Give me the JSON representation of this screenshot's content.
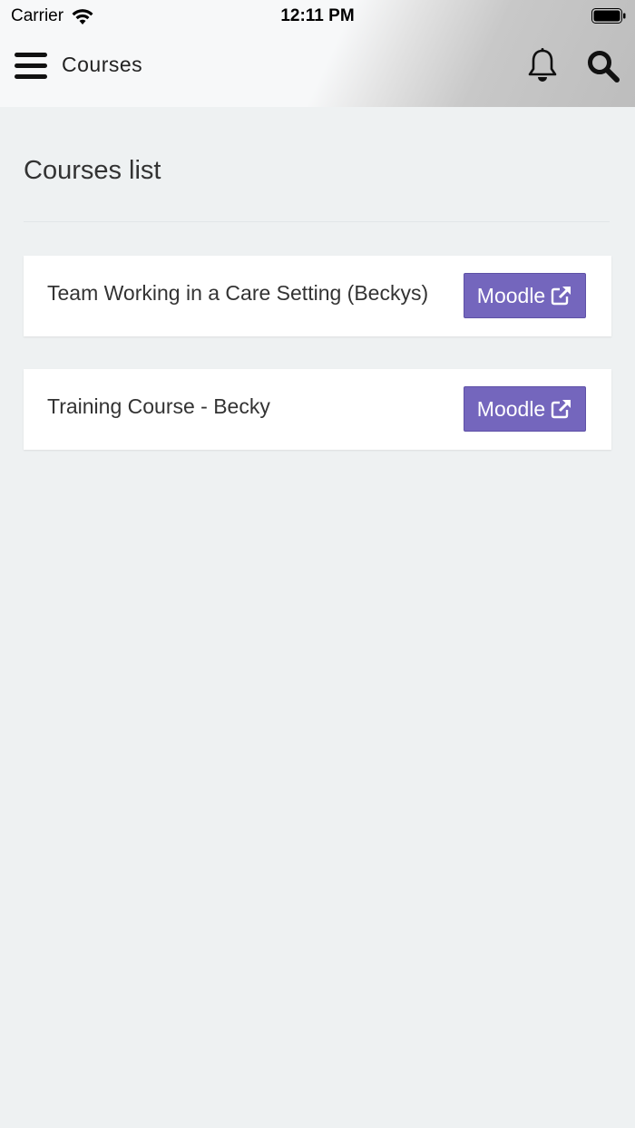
{
  "status_bar": {
    "carrier": "Carrier",
    "time": "12:11 PM"
  },
  "header": {
    "title": "Courses",
    "icons": [
      "menu-icon",
      "bell-icon",
      "search-icon"
    ]
  },
  "main": {
    "title": "Courses list",
    "courses": [
      {
        "name": "Team Working in a Care Setting (Beckys)",
        "button_label": "Moodle"
      },
      {
        "name": "Training Course - Becky",
        "button_label": "Moodle"
      }
    ]
  },
  "colors": {
    "accent": "#7466bd",
    "background": "#eef1f2"
  }
}
